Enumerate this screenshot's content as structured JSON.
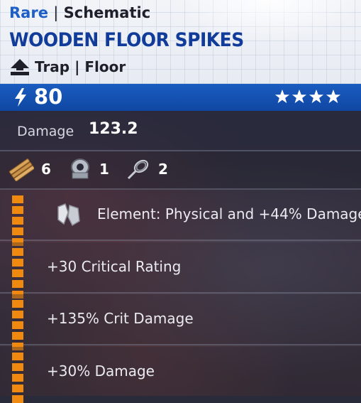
{
  "header": {
    "rarity": "Rare",
    "separator": "|",
    "category": "Schematic",
    "title": "WOODEN FLOOR SPIKES",
    "type_icon": "floor-trap-icon",
    "type": "Trap | Floor"
  },
  "power_bar": {
    "icon": "lightning-bolt-icon",
    "power": "80",
    "stars": 4,
    "star_icon": "star-icon",
    "accent_color": "#1a5cc0"
  },
  "stats": {
    "damage_label": "Damage",
    "damage_value": "123.2"
  },
  "materials": [
    {
      "icon": "planks-icon",
      "count": "6"
    },
    {
      "icon": "duct-tape-icon",
      "count": "1"
    },
    {
      "icon": "wire-coil-icon",
      "count": "2"
    }
  ],
  "perks": [
    {
      "icon": "element-physical-icon",
      "text": "Element: Physical and +44% Damage",
      "pips": 5
    },
    {
      "text": "+30 Critical Rating",
      "pips": 5
    },
    {
      "text": "+135% Crit Damage",
      "pips": 5
    },
    {
      "text": "+30% Damage",
      "pips": 5
    }
  ],
  "colors": {
    "rarity_blue": "#1d5fc7",
    "title_blue": "#123c9a",
    "pip_orange": "#f0890f"
  }
}
